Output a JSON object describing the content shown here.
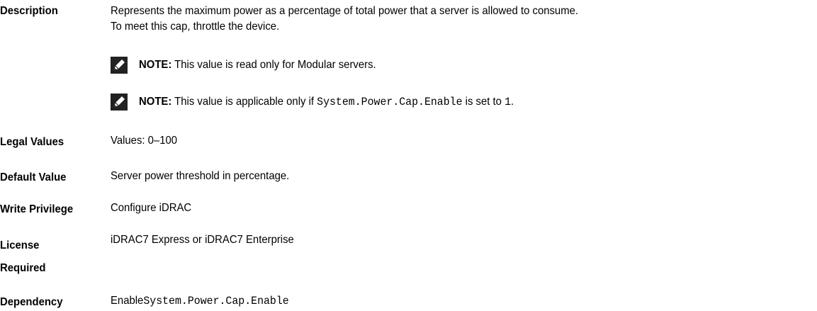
{
  "description": {
    "label": "Description",
    "line1": "Represents the maximum power as a percentage of total power that a server is allowed to consume.",
    "line2": "To meet this cap, throttle the device.",
    "note1": {
      "prefix": "NOTE:",
      "text": " This value is read only for Modular servers."
    },
    "note2": {
      "prefix": "NOTE:",
      "text_before": " This value is applicable only if ",
      "code": "System.Power.Cap.Enable",
      "text_mid": " is set to ",
      "code_value": "1",
      "text_after": "."
    },
    "note_icon": "pencil-note-icon"
  },
  "legal_values": {
    "label": "Legal Values",
    "value": "Values: 0–100"
  },
  "default_value": {
    "label": "Default Value",
    "value": "Server power threshold in percentage."
  },
  "write_privilege": {
    "label": "Write Privilege",
    "value": "Configure iDRAC"
  },
  "license_required": {
    "label_line1": "License",
    "label_line2": "Required",
    "value": "iDRAC7 Express or iDRAC7 Enterprise"
  },
  "dependency": {
    "label": "Dependency",
    "value_prefix": "Enable",
    "value_code": "System.Power.Cap.Enable"
  }
}
